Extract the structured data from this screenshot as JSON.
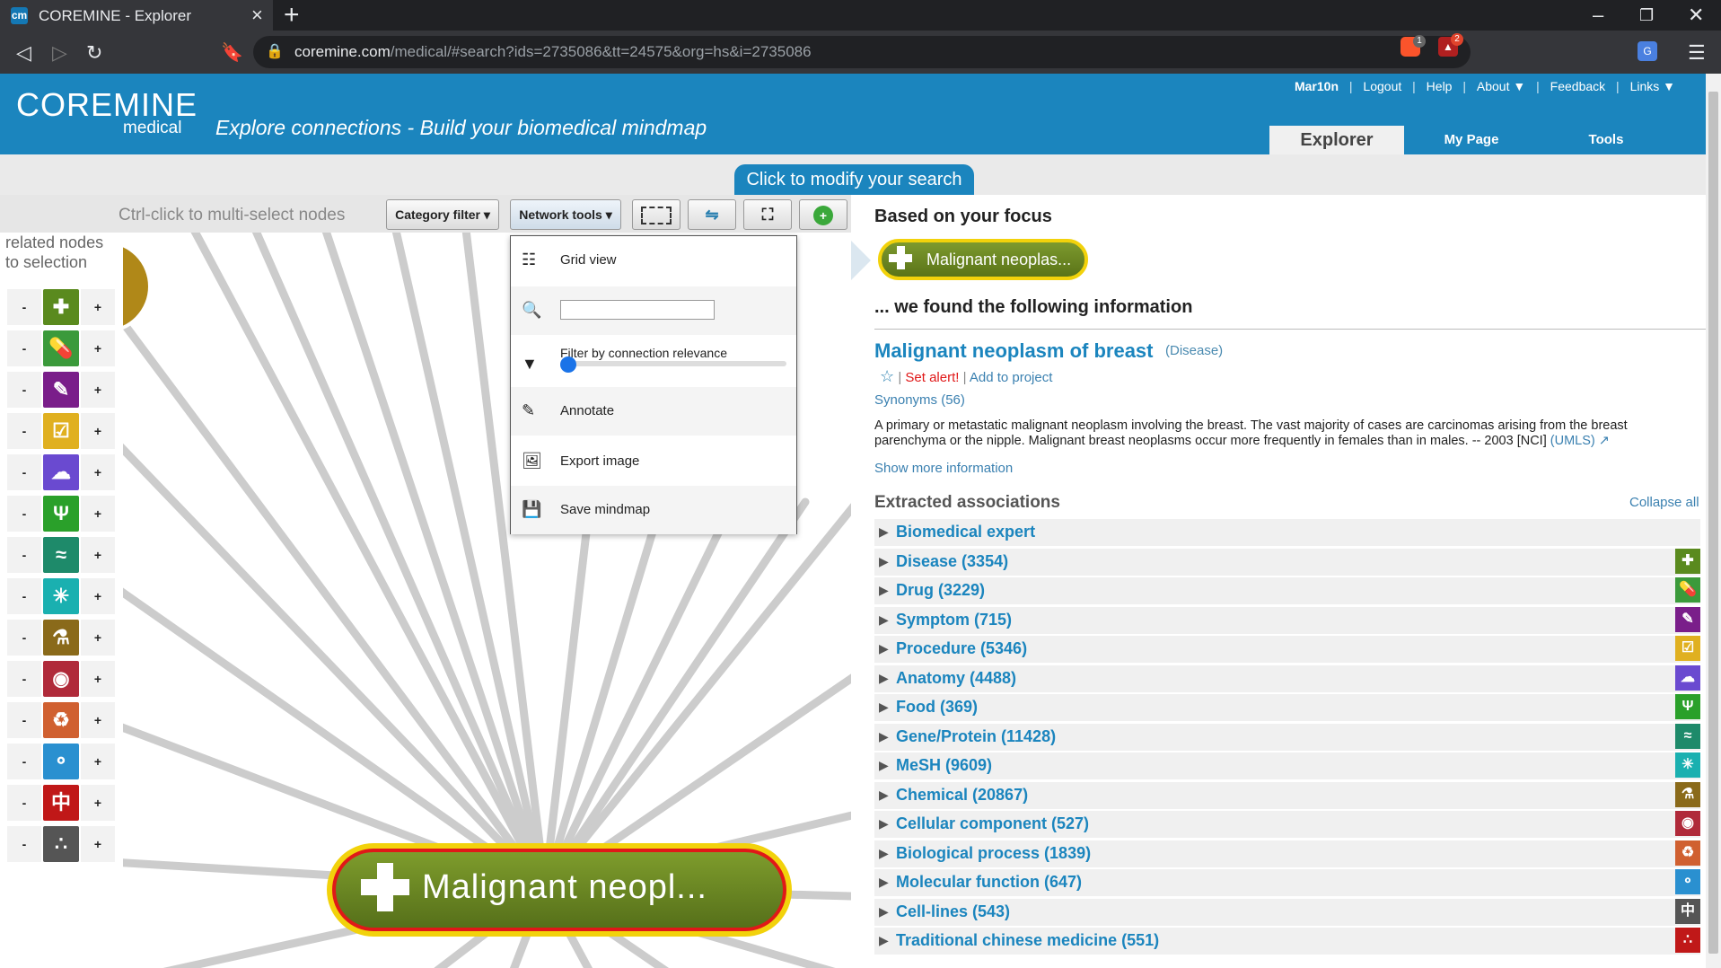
{
  "browser": {
    "tab_title": "COREMINE - Explorer",
    "tab_favicon": "cm",
    "url_host": "coremine.com",
    "url_path": "/medical/#search?ids=2735086&tt=24575&org=hs&i=2735086",
    "brave_badge": "1",
    "ext_badge": "2"
  },
  "header": {
    "logo": "COREMINE",
    "logo_sub": "medical",
    "tagline": "Explore connections - Build your biomedical mindmap",
    "links": {
      "user": "Mar10n",
      "logout": "Logout",
      "help": "Help",
      "about": "About ▼",
      "feedback": "Feedback",
      "links": "Links ▼"
    },
    "tabs": [
      "Explorer",
      "My Page",
      "Tools"
    ],
    "modify_search": "Click to modify your search"
  },
  "toolbar": {
    "hint": "Ctrl-click to multi-select nodes",
    "category_filter": "Category filter",
    "network_tools": "Network tools"
  },
  "sidebar": {
    "hint_line1": "related nodes",
    "hint_line2": "to selection",
    "minus": "-",
    "plus": "+"
  },
  "dropdown": {
    "grid_view": "Grid view",
    "filter_label": "Filter by connection relevance",
    "annotate": "Annotate",
    "export_image": "Export image",
    "save_mindmap": "Save mindmap",
    "search_value": ""
  },
  "graph": {
    "center_node": "Malignant neopl..."
  },
  "info": {
    "focus_heading": "Based on your focus",
    "focus_pill": "Malignant neoplas...",
    "found_heading": "... we found the following information",
    "title": "Malignant neoplasm of breast",
    "category": "(Disease)",
    "set_alert": "Set alert!",
    "add_project": "Add to project",
    "synonyms": "Synonyms (56)",
    "description": "A primary or metastatic malignant neoplasm involving the breast. The vast majority of cases are carcinomas arising from the breast parenchyma or the nipple. Malignant breast neoplasms occur more frequently in females than in males. -- 2003 [NCI]",
    "umls": "(UMLS)",
    "show_more": "Show more information",
    "extracted_heading": "Extracted associations",
    "collapse_all": "Collapse all",
    "associations": [
      {
        "label": "Biomedical expert",
        "color": ""
      },
      {
        "label": "Disease (3354)",
        "color": "#5a8a1e"
      },
      {
        "label": "Drug (3229)",
        "color": "#3b9a3b"
      },
      {
        "label": "Symptom (715)",
        "color": "#7a1e8a"
      },
      {
        "label": "Procedure (5346)",
        "color": "#e0b020"
      },
      {
        "label": "Anatomy (4488)",
        "color": "#6a4ad0"
      },
      {
        "label": "Food (369)",
        "color": "#2aa02a"
      },
      {
        "label": "Gene/Protein (11428)",
        "color": "#1e8a6a"
      },
      {
        "label": "MeSH (9609)",
        "color": "#1ab0b0"
      },
      {
        "label": "Chemical (20867)",
        "color": "#8a6a1a"
      },
      {
        "label": "Cellular component (527)",
        "color": "#b02a3a"
      },
      {
        "label": "Biological process (1839)",
        "color": "#d06030"
      },
      {
        "label": "Molecular function (647)",
        "color": "#2a90d0"
      },
      {
        "label": "Cell-lines (543)",
        "color": "#555555"
      },
      {
        "label": "Traditional chinese medicine (551)",
        "color": "#c01818"
      }
    ]
  },
  "categories": [
    {
      "icon": "plus-icon",
      "glyph": "✚",
      "color": "#5a8a1e"
    },
    {
      "icon": "pill-icon",
      "glyph": "💊",
      "color": "#3b9a3b"
    },
    {
      "icon": "syringe-icon",
      "glyph": "✎",
      "color": "#7a1e8a"
    },
    {
      "icon": "checklist-icon",
      "glyph": "☑",
      "color": "#e0b020"
    },
    {
      "icon": "brain-icon",
      "glyph": "☁",
      "color": "#6a4ad0"
    },
    {
      "icon": "food-icon",
      "glyph": "Ψ",
      "color": "#2aa02a"
    },
    {
      "icon": "gene-icon",
      "glyph": "≈",
      "color": "#1e8a6a"
    },
    {
      "icon": "tree-icon",
      "glyph": "✳",
      "color": "#1ab0b0"
    },
    {
      "icon": "flask-icon",
      "glyph": "⚗",
      "color": "#8a6a1a"
    },
    {
      "icon": "cell-icon",
      "glyph": "◉",
      "color": "#b02a3a"
    },
    {
      "icon": "recycle-icon",
      "glyph": "♻",
      "color": "#d06030"
    },
    {
      "icon": "molecule-icon",
      "glyph": "⚬",
      "color": "#2a90d0"
    },
    {
      "icon": "tcm-icon",
      "glyph": "中",
      "color": "#c01818"
    },
    {
      "icon": "cells-icon",
      "glyph": "∴",
      "color": "#555555"
    }
  ]
}
